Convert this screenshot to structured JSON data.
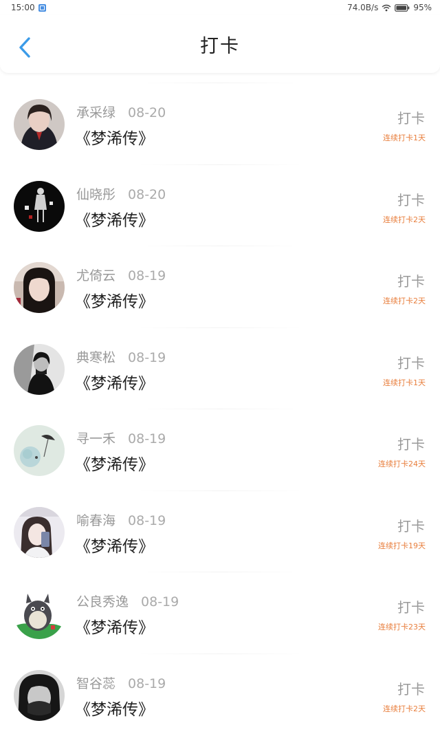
{
  "status_bar": {
    "time": "15:00",
    "net_speed": "74.0B/s",
    "battery": "95%"
  },
  "header": {
    "title": "打卡",
    "back_icon": "chevron-left-icon"
  },
  "colors": {
    "accent": "#3b9be8",
    "streak": "#e87e3c"
  },
  "items": [
    {
      "name": "承采绿",
      "date": "08-20",
      "book": "《梦浠传》",
      "action": "打卡",
      "streak": "连续打卡1天"
    },
    {
      "name": "仙晓彤",
      "date": "08-20",
      "book": "《梦浠传》",
      "action": "打卡",
      "streak": "连续打卡2天"
    },
    {
      "name": "尤倚云",
      "date": "08-19",
      "book": "《梦浠传》",
      "action": "打卡",
      "streak": "连续打卡2天"
    },
    {
      "name": "典寒松",
      "date": "08-19",
      "book": "《梦浠传》",
      "action": "打卡",
      "streak": "连续打卡1天"
    },
    {
      "name": "寻一禾",
      "date": "08-19",
      "book": "《梦浠传》",
      "action": "打卡",
      "streak": "连续打卡24天"
    },
    {
      "name": "喻春海",
      "date": "08-19",
      "book": "《梦浠传》",
      "action": "打卡",
      "streak": "连续打卡19天"
    },
    {
      "name": "公良秀逸",
      "date": "08-19",
      "book": "《梦浠传》",
      "action": "打卡",
      "streak": "连续打卡23天"
    },
    {
      "name": "智谷蕊",
      "date": "08-19",
      "book": "《梦浠传》",
      "action": "打卡",
      "streak": "连续打卡2天"
    }
  ]
}
